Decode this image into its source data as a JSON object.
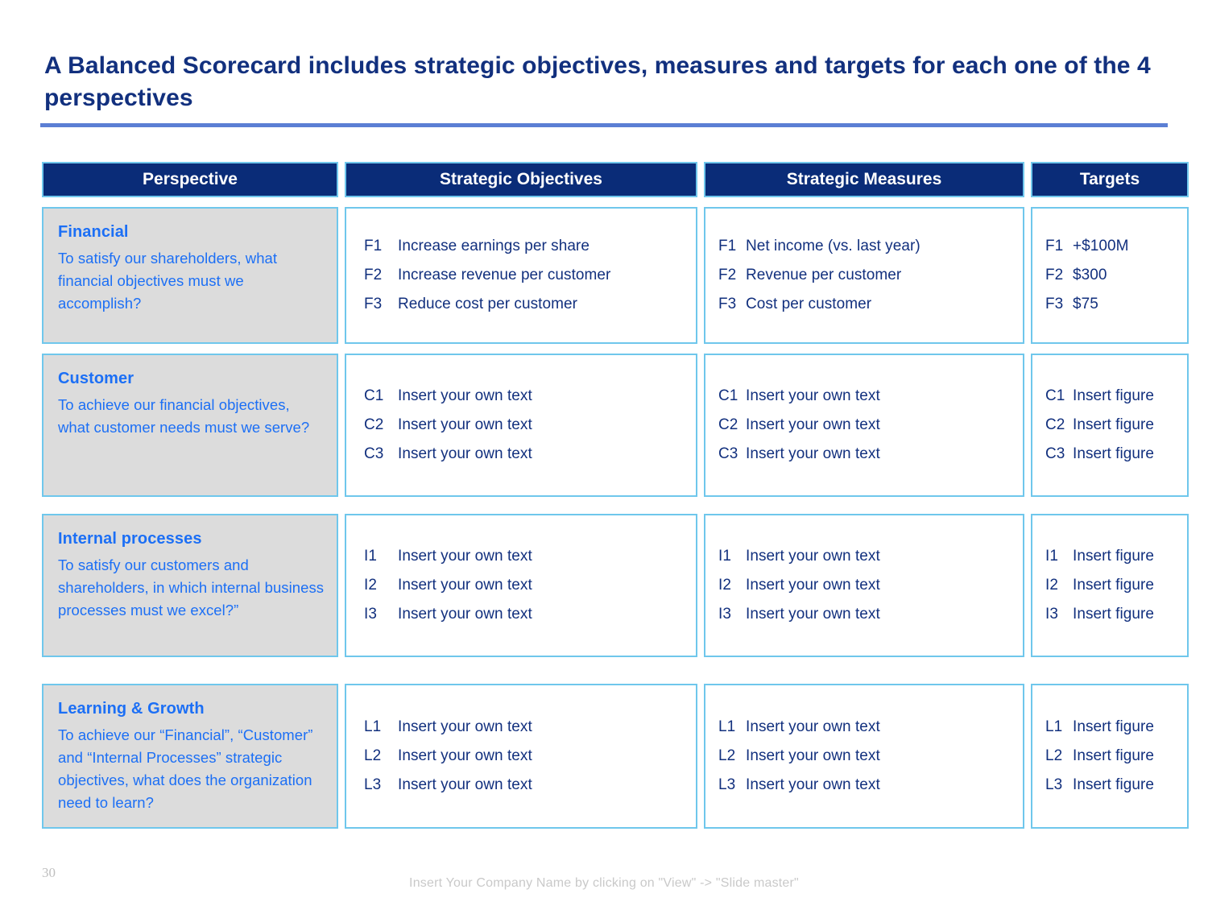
{
  "slide": {
    "title": "A Balanced Scorecard includes strategic objectives, measures and targets for each one of the 4 perspectives",
    "page_number": "30",
    "footer_note": "Insert Your Company Name by clicking on \"View\" -> \"Slide master\"",
    "colors": {
      "title_blue": "#12307E",
      "rule_blue": "#5B7FD4",
      "header_navy": "#0A2C78",
      "cell_border": "#6FC7EC",
      "perspective_fill": "#DCDCDC",
      "perspective_text": "#1C6FF5",
      "body_text": "#12307E",
      "footer_gray": "#C9C9C9"
    }
  },
  "table": {
    "headers": [
      {
        "label": "Perspective"
      },
      {
        "label": "Strategic Objectives"
      },
      {
        "label": "Strategic Measures"
      },
      {
        "label": "Targets"
      }
    ],
    "rows": [
      {
        "key": "financial",
        "perspective": {
          "title": "Financial",
          "description": "To satisfy our shareholders, what financial objectives must we accomplish?"
        },
        "objectives": [
          {
            "code": "F1",
            "text": "Increase earnings per share"
          },
          {
            "code": "F2",
            "text": "Increase revenue per customer"
          },
          {
            "code": "F3",
            "text": "Reduce cost per customer"
          }
        ],
        "measures": [
          {
            "code": "F1",
            "text": "Net income (vs. last year)"
          },
          {
            "code": "F2",
            "text": "Revenue per customer"
          },
          {
            "code": "F3",
            "text": "Cost per customer"
          }
        ],
        "targets": [
          {
            "code": "F1",
            "text": "+$100M"
          },
          {
            "code": "F2",
            "text": "$300"
          },
          {
            "code": "F3",
            "text": "$75"
          }
        ]
      },
      {
        "key": "customer",
        "perspective": {
          "title": "Customer",
          "description": "To achieve our financial objectives, what customer needs must we serve?"
        },
        "objectives": [
          {
            "code": "C1",
            "text": "Insert your own text"
          },
          {
            "code": "C2",
            "text": "Insert your own text"
          },
          {
            "code": "C3",
            "text": "Insert your own text"
          }
        ],
        "measures": [
          {
            "code": "C1",
            "text": "Insert your own text"
          },
          {
            "code": "C2",
            "text": "Insert your own text"
          },
          {
            "code": "C3",
            "text": "Insert your own text"
          }
        ],
        "targets": [
          {
            "code": "C1",
            "text": "Insert figure"
          },
          {
            "code": "C2",
            "text": "Insert figure"
          },
          {
            "code": "C3",
            "text": "Insert figure"
          }
        ]
      },
      {
        "key": "internal-processes",
        "perspective": {
          "title": "Internal processes",
          "description": "To satisfy our customers and shareholders, in which internal business processes must we excel?”"
        },
        "objectives": [
          {
            "code": "I1",
            "text": "Insert your own text"
          },
          {
            "code": "I2",
            "text": "Insert your own text"
          },
          {
            "code": "I3",
            "text": "Insert your own text"
          }
        ],
        "measures": [
          {
            "code": "I1",
            "text": "Insert your own text"
          },
          {
            "code": "I2",
            "text": "Insert your own text"
          },
          {
            "code": "I3",
            "text": "Insert your own text"
          }
        ],
        "targets": [
          {
            "code": "I1",
            "text": "Insert figure"
          },
          {
            "code": "I2",
            "text": "Insert figure"
          },
          {
            "code": "I3",
            "text": "Insert figure"
          }
        ]
      },
      {
        "key": "learning-growth",
        "perspective": {
          "title": "Learning & Growth",
          "description": "To achieve our “Financial”, “Customer” and “Internal Processes” strategic objectives, what does the organization need to learn?"
        },
        "objectives": [
          {
            "code": "L1",
            "text": "Insert your own text"
          },
          {
            "code": "L2",
            "text": "Insert your own text"
          },
          {
            "code": "L3",
            "text": "Insert your own text"
          }
        ],
        "measures": [
          {
            "code": "L1",
            "text": "Insert your own text"
          },
          {
            "code": "L2",
            "text": "Insert your own text"
          },
          {
            "code": "L3",
            "text": "Insert your own text"
          }
        ],
        "targets": [
          {
            "code": "L1",
            "text": "Insert figure"
          },
          {
            "code": "L2",
            "text": "Insert figure"
          },
          {
            "code": "L3",
            "text": "Insert figure"
          }
        ]
      }
    ]
  }
}
